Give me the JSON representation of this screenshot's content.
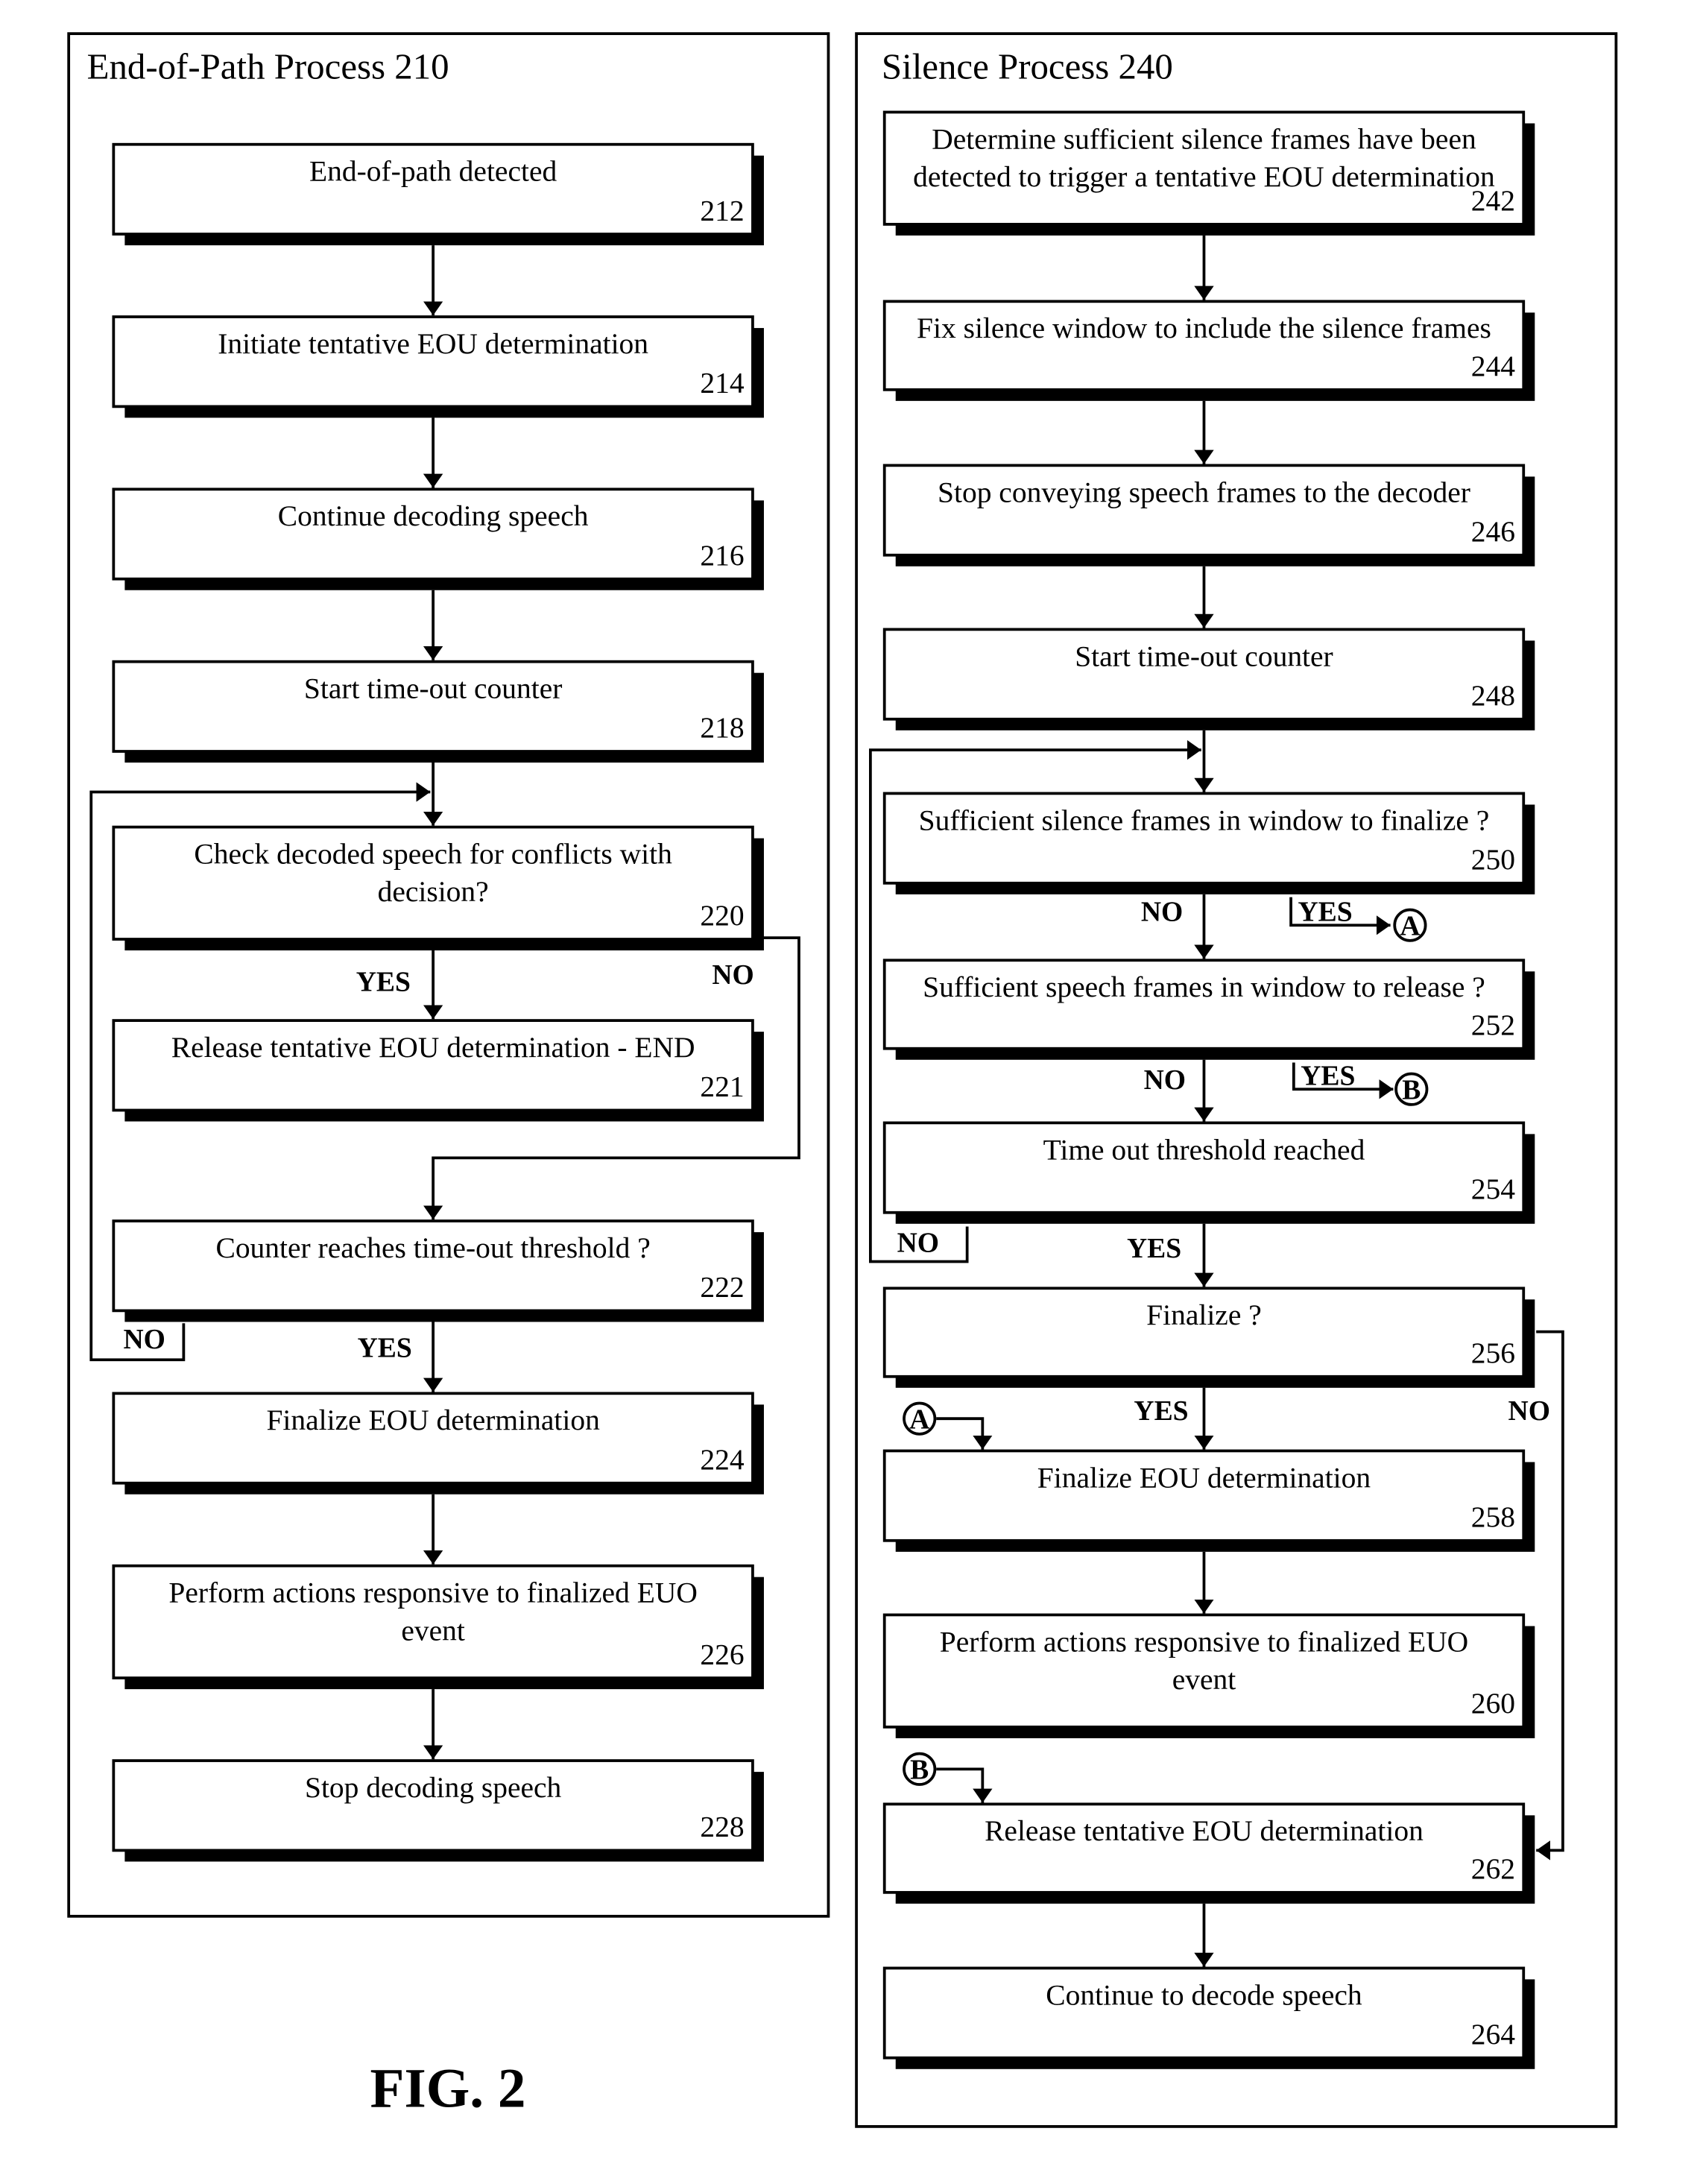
{
  "figure_label": "FIG. 2",
  "left_panel": {
    "title": "End-of-Path Process 210",
    "steps": [
      {
        "id": "212",
        "lines": [
          "End-of-path detected"
        ]
      },
      {
        "id": "214",
        "lines": [
          "Initiate tentative EOU determination"
        ]
      },
      {
        "id": "216",
        "lines": [
          "Continue decoding speech"
        ]
      },
      {
        "id": "218",
        "lines": [
          "Start time-out counter"
        ]
      },
      {
        "id": "220",
        "lines": [
          "Check decoded speech for conflicts with",
          "decision?"
        ]
      },
      {
        "id": "221",
        "lines": [
          "Release tentative EOU determination - END"
        ]
      },
      {
        "id": "222",
        "lines": [
          "Counter reaches time-out threshold ?"
        ]
      },
      {
        "id": "224",
        "lines": [
          "Finalize EOU determination"
        ]
      },
      {
        "id": "226",
        "lines": [
          "Perform actions responsive to finalized EUO",
          "event"
        ]
      },
      {
        "id": "228",
        "lines": [
          "Stop decoding speech"
        ]
      }
    ],
    "branch_labels": {
      "yes_220": "YES",
      "no_220": "NO",
      "no_222": "NO",
      "yes_222": "YES"
    }
  },
  "right_panel": {
    "title": "Silence Process 240",
    "steps": [
      {
        "id": "242",
        "lines": [
          "Determine sufficient silence frames have been",
          "detected to trigger a tentative EOU determination"
        ]
      },
      {
        "id": "244",
        "lines": [
          "Fix silence window to include the silence frames"
        ]
      },
      {
        "id": "246",
        "lines": [
          "Stop conveying speech frames to the decoder"
        ]
      },
      {
        "id": "248",
        "lines": [
          "Start time-out counter"
        ]
      },
      {
        "id": "250",
        "lines": [
          "Sufficient silence frames in window to finalize ?"
        ]
      },
      {
        "id": "252",
        "lines": [
          "Sufficient speech frames in window to release ?"
        ]
      },
      {
        "id": "254",
        "lines": [
          "Time out threshold reached"
        ]
      },
      {
        "id": "256",
        "lines": [
          "Finalize ?"
        ]
      },
      {
        "id": "258",
        "lines": [
          "Finalize EOU determination"
        ]
      },
      {
        "id": "260",
        "lines": [
          "Perform actions responsive to finalized EUO",
          "event"
        ]
      },
      {
        "id": "262",
        "lines": [
          "Release tentative EOU determination"
        ]
      },
      {
        "id": "264",
        "lines": [
          "Continue to decode speech"
        ]
      }
    ],
    "branch_labels": {
      "no_250": "NO",
      "yes_250": "YES",
      "no_252": "NO",
      "yes_252": "YES",
      "no_254": "NO",
      "yes_254": "YES",
      "yes_256": "YES",
      "no_256": "NO"
    },
    "connectors": {
      "a": "A",
      "b": "B"
    }
  }
}
